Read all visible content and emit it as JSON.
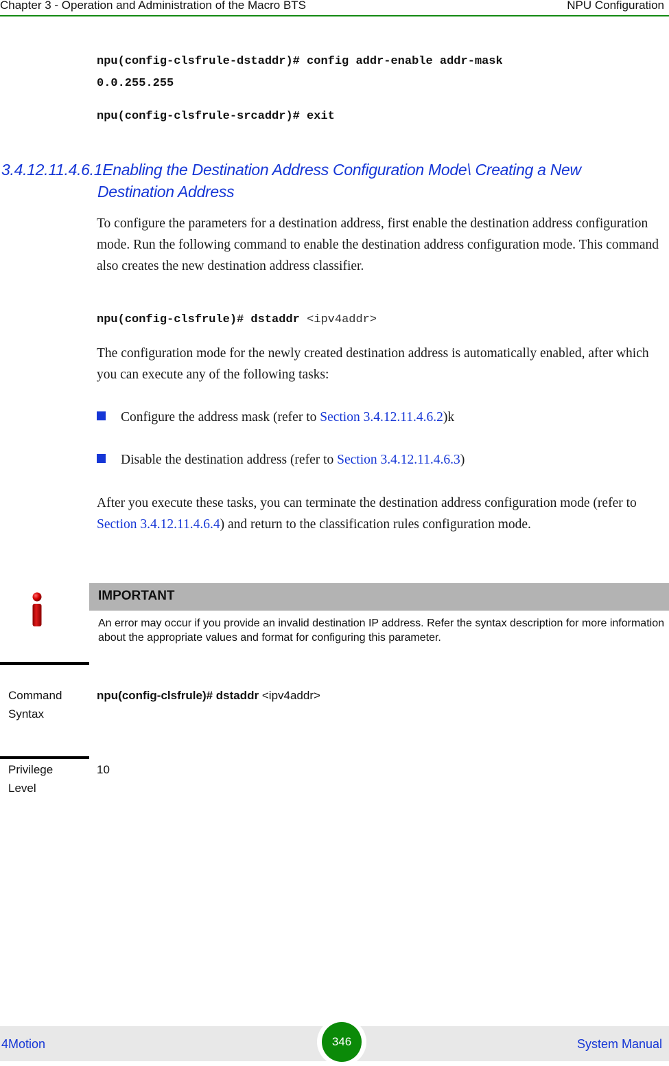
{
  "header": {
    "chapter": "Chapter 3 - Operation and Administration of the Macro BTS",
    "section": "NPU Configuration"
  },
  "code_block_1": {
    "line1": "npu(config-clsfrule-dstaddr)# config addr-enable addr-mask",
    "line2": "0.0.255.255",
    "line3": "npu(config-clsfrule-srcaddr)# exit"
  },
  "section": {
    "number": "3.4.12.11.4.6.1",
    "title_line1": "Enabling the Destination Address Configuration Mode\\ Creating a New",
    "title_line2": "Destination Address"
  },
  "intro_paragraph": "To configure the parameters for a destination address, first enable the destination address configuration mode. Run the following command to enable the destination address configuration mode. This command also creates the new destination address classifier.",
  "command": {
    "prefix": "npu(config-clsfrule)# dstaddr",
    "arg": "<ipv4addr>"
  },
  "mode_paragraph": "The configuration mode for the newly created destination address is automatically enabled, after which you can execute any of the following tasks:",
  "tasks": [
    {
      "text": "Configure the address mask (refer to ",
      "link": "Section 3.4.12.11.4.6.2",
      "suffix": ")k"
    },
    {
      "text": "Disable the destination address (refer to ",
      "link": "Section 3.4.12.11.4.6.3",
      "suffix": ")"
    }
  ],
  "after_paragraph": {
    "before": "After you execute these tasks, you can terminate the destination address configuration mode (refer to ",
    "link": "Section 3.4.12.11.4.6.4",
    "after": ") and return to the classification rules configuration mode."
  },
  "important": {
    "icon": "info-icon",
    "title": "IMPORTANT",
    "text": "An error may occur if you provide an invalid destination IP address. Refer the syntax description for more information about the appropriate values and format for configuring this parameter."
  },
  "command_syntax": {
    "label_line1": "Command",
    "label_line2": "Syntax",
    "bold": "npu(config-clsfrule)# dstaddr",
    "arg": "<ipv4addr>"
  },
  "privilege_level": {
    "label_line1": "Privilege",
    "label_line2": "Level",
    "value": "10"
  },
  "footer": {
    "product": "4Motion",
    "page_number": "346",
    "manual": "System Manual"
  },
  "colors": {
    "accent_green": "#138a12",
    "link_blue": "#1536d6",
    "page_badge_green": "#0b8a08",
    "important_bar_gray": "#b3b3b3",
    "footer_gray": "#e8e8e8",
    "icon_red": "#d40000"
  }
}
